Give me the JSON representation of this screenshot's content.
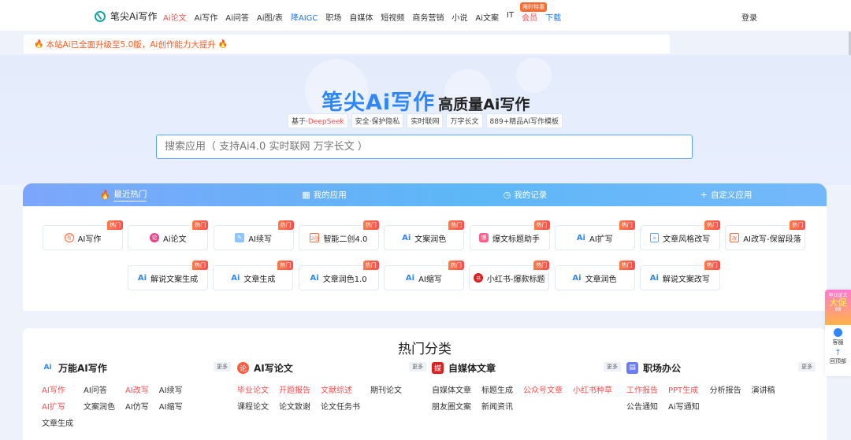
{
  "brand": {
    "name": "笔尖Ai写作"
  },
  "nav": {
    "items": [
      "Ai论文",
      "Ai写作",
      "Ai问答",
      "Ai图/表",
      "降AIGC",
      "职场",
      "自媒体",
      "短视频",
      "商务营销",
      "小说",
      "Ai文案",
      "IT",
      "会员",
      "下载"
    ],
    "badge": "限时特惠",
    "login": "登录"
  },
  "notice": {
    "text": "本站Ai已全面升级至5.0版，Ai创作能力大提升"
  },
  "hero": {
    "title_main": "笔尖Ai写作",
    "title_sub": "高质量Ai写作",
    "tags": [
      {
        "prefix": "基于·",
        "highlight": "DeepSeek"
      },
      {
        "prefix": "安全·保护隐私",
        "highlight": ""
      },
      {
        "prefix": "实时联网",
        "highlight": ""
      },
      {
        "prefix": "万字长文",
        "highlight": ""
      },
      {
        "prefix": "889+精品AI写作模板",
        "highlight": ""
      }
    ],
    "search_placeholder": "搜索应用（ 支持Ai4.0 实时联网 万字长文 ）"
  },
  "tabs": [
    {
      "icon": "🔥",
      "label": "最近热门"
    },
    {
      "icon": "▦",
      "label": "我的应用"
    },
    {
      "icon": "◷",
      "label": "我的记录"
    },
    {
      "icon": "+",
      "label": "自定义应用"
    }
  ],
  "hot_badge": "热门",
  "apps_row1": [
    {
      "icon": "round",
      "glyph": "写",
      "label": "AI写作"
    },
    {
      "icon": "pink",
      "glyph": "论",
      "label": "Ai论文"
    },
    {
      "icon": "pen",
      "glyph": "✎",
      "label": "AI续写"
    },
    {
      "icon": "sq",
      "glyph": "2创",
      "label": "智能二创4.0"
    },
    {
      "icon": "ai",
      "glyph": "Ai",
      "label": "文案润色"
    },
    {
      "icon": "bag",
      "glyph": "爆",
      "label": "爆文标题助手"
    },
    {
      "icon": "ai",
      "glyph": "Ai",
      "label": "AI扩写"
    },
    {
      "icon": "doc",
      "glyph": "≡",
      "label": "文章风格改写"
    },
    {
      "icon": "sq",
      "glyph": "改",
      "label": "AI改写-保留段落"
    }
  ],
  "apps_row2": [
    {
      "icon": "ai",
      "glyph": "Ai",
      "label": "解说文案生成"
    },
    {
      "icon": "ai",
      "glyph": "Ai",
      "label": "文章生成"
    },
    {
      "icon": "ai",
      "glyph": "Ai",
      "label": "文章润色1.0"
    },
    {
      "icon": "ai",
      "glyph": "Ai",
      "label": "AI缩写"
    },
    {
      "icon": "red",
      "glyph": "书",
      "label": "小红书-爆款标题"
    },
    {
      "icon": "ai",
      "glyph": "Ai",
      "label": "文章润色"
    },
    {
      "icon": "ai",
      "glyph": "Ai",
      "label": "解说文案改写"
    }
  ],
  "categories": {
    "title": "热门分类",
    "more": "更多",
    "columns": [
      {
        "title": "万能AI写作",
        "icon_glyph": "Ai",
        "links": [
          {
            "t": "AI写作",
            "hot": true
          },
          {
            "t": "AI问答",
            "hot": false
          },
          {
            "t": "AI改写",
            "hot": true
          },
          {
            "t": "AI续写",
            "hot": false
          },
          {
            "t": "AI扩写",
            "hot": true
          },
          {
            "t": "文案润色",
            "hot": false
          },
          {
            "t": "AI仿写",
            "hot": false
          },
          {
            "t": "AI缩写",
            "hot": false
          },
          {
            "t": "文章生成",
            "hot": false
          }
        ]
      },
      {
        "title": "AI写论文",
        "icon_glyph": "论",
        "links": [
          {
            "t": "毕业论文",
            "hot": true
          },
          {
            "t": "开题报告",
            "hot": true
          },
          {
            "t": "文献综述",
            "hot": true
          },
          {
            "t": "期刊论文",
            "hot": false
          },
          {
            "t": "课程论文",
            "hot": false
          },
          {
            "t": "论文致谢",
            "hot": false
          },
          {
            "t": "论文任务书",
            "hot": false
          }
        ]
      },
      {
        "title": "自媒体文章",
        "icon_glyph": "媒",
        "links": [
          {
            "t": "自媒体文章",
            "hot": false
          },
          {
            "t": "标题生成",
            "hot": false
          },
          {
            "t": "公众号文章",
            "hot": true
          },
          {
            "t": "小红书种草",
            "hot": true
          },
          {
            "t": "朋友圈文案",
            "hot": false
          },
          {
            "t": "新闻资讯",
            "hot": false
          }
        ]
      },
      {
        "title": "职场办公",
        "icon_glyph": "▤",
        "links": [
          {
            "t": "工作报告",
            "hot": true
          },
          {
            "t": "PPT生成",
            "hot": true
          },
          {
            "t": "分析报告",
            "hot": false
          },
          {
            "t": "演讲稿",
            "hot": false
          },
          {
            "t": "公告通知",
            "hot": false
          },
          {
            "t": "Ai写通知",
            "hot": false
          }
        ]
      }
    ]
  },
  "side": {
    "promo_line1": "毕业论文",
    "promo_big": "大促",
    "promo_num": "98",
    "service": "客服",
    "top": "回顶部"
  },
  "colors": {
    "accent": "#2f86f6",
    "hot": "#ff4d4f",
    "orange": "#ff6a2f"
  }
}
